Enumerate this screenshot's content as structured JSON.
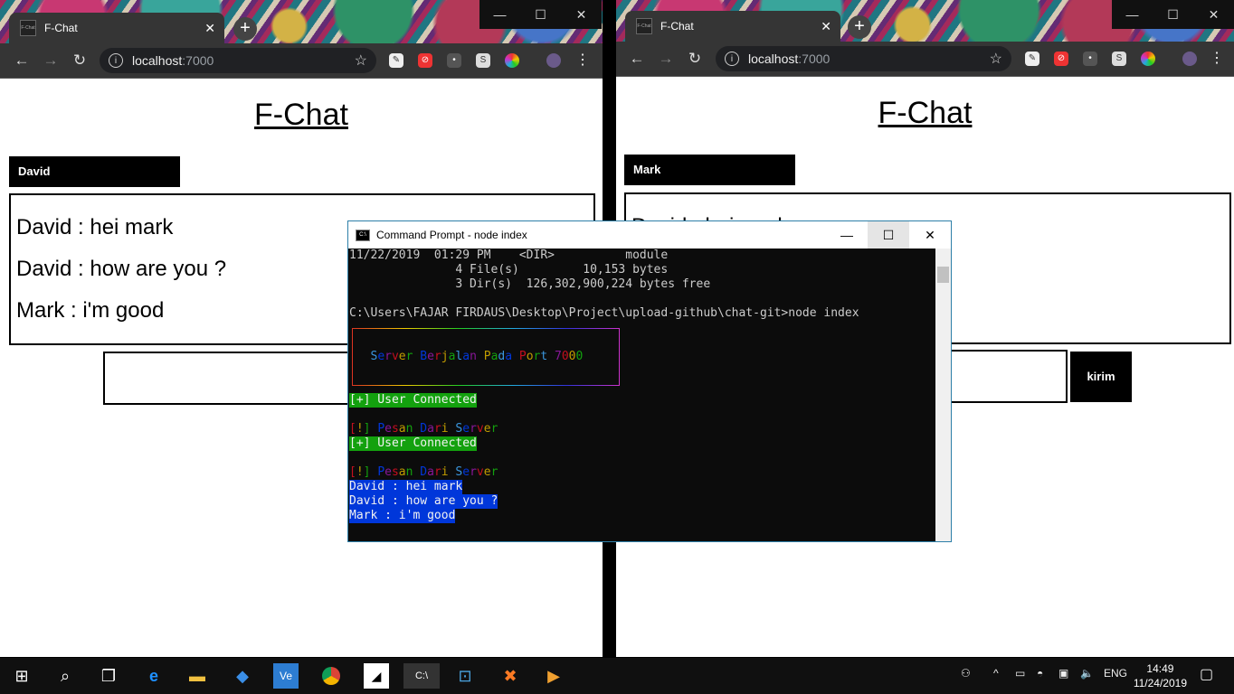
{
  "left": {
    "tab_title": "F-Chat",
    "url": "localhost",
    "url_port": ":7000",
    "page_title": "F-Chat",
    "username": "David",
    "messages": [
      "David : hei mark",
      "David : how are you ?",
      "Mark : i'm good"
    ]
  },
  "right": {
    "tab_title": "F-Chat",
    "url": "localhost",
    "url_port": ":7000",
    "page_title": "F-Chat",
    "username": "Mark",
    "messages": [
      "David : hei mark"
    ],
    "send_label": "kirim"
  },
  "cmd": {
    "title": "Command Prompt - node  index",
    "lines": [
      {
        "text": "11/22/2019  01:29 PM    <DIR>          module",
        "style": "plain"
      },
      {
        "text": "               4 File(s)         10,153 bytes",
        "style": "plain"
      },
      {
        "text": "               3 Dir(s)  126,302,900,224 bytes free",
        "style": "plain"
      },
      {
        "text": "",
        "style": "plain"
      },
      {
        "text": "C:\\Users\\FAJAR FIRDAUS\\Desktop\\Project\\upload-github\\chat-git>node index",
        "style": "plain"
      },
      {
        "text": "   Server Berjalan Pada Port 7000",
        "style": "rainbow"
      },
      {
        "text": "[+] User Connected",
        "style": "green"
      },
      {
        "text": "",
        "style": "plain"
      },
      {
        "text": "[!] Pesan Dari Server",
        "style": "rainbow"
      },
      {
        "text": "[+] User Connected",
        "style": "green"
      },
      {
        "text": "",
        "style": "plain"
      },
      {
        "text": "[!] Pesan Dari Server",
        "style": "rainbow"
      },
      {
        "text": "David : hei mark",
        "style": "blue"
      },
      {
        "text": "David : how are you ?",
        "style": "blue"
      },
      {
        "text": "Mark : i'm good",
        "style": "blue"
      }
    ],
    "rainbow_colors": [
      "#c50f1f",
      "#c19c00",
      "#13a10e",
      "#3a96dd",
      "#0037da",
      "#881798"
    ]
  },
  "taskbar": {
    "icons": [
      "windows-start-icon",
      "search-icon",
      "task-view-icon",
      "edge-icon",
      "file-explorer-icon",
      "vscode-icon",
      "vs-icon",
      "chrome-icon",
      "sticky-notes-icon",
      "cmd-icon",
      "network-app-icon",
      "xampp-icon",
      "media-player-icon"
    ],
    "language": "ENG",
    "time": "14:49",
    "date": "11/24/2019"
  }
}
